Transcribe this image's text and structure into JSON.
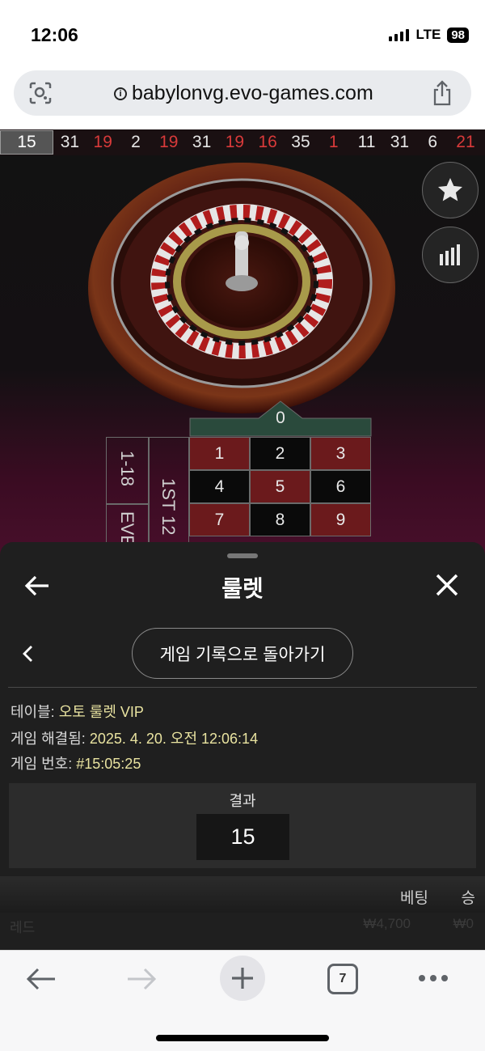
{
  "status": {
    "time": "12:06",
    "network": "LTE",
    "battery": "98"
  },
  "browser": {
    "url": "babylonvg.evo-games.com",
    "tab_count": "7"
  },
  "game": {
    "history": [
      {
        "n": "15",
        "c": "current"
      },
      {
        "n": "31",
        "c": "black"
      },
      {
        "n": "19",
        "c": "red"
      },
      {
        "n": "2",
        "c": "black"
      },
      {
        "n": "19",
        "c": "red"
      },
      {
        "n": "31",
        "c": "black"
      },
      {
        "n": "19",
        "c": "red"
      },
      {
        "n": "16",
        "c": "red"
      },
      {
        "n": "35",
        "c": "black"
      },
      {
        "n": "1",
        "c": "red"
      },
      {
        "n": "11",
        "c": "black"
      },
      {
        "n": "31",
        "c": "black"
      },
      {
        "n": "6",
        "c": "black"
      },
      {
        "n": "21",
        "c": "red"
      }
    ],
    "zero_label": "0",
    "cells": [
      {
        "n": "1",
        "c": "red"
      },
      {
        "n": "2",
        "c": "black"
      },
      {
        "n": "3",
        "c": "red"
      },
      {
        "n": "4",
        "c": "black"
      },
      {
        "n": "5",
        "c": "red"
      },
      {
        "n": "6",
        "c": "black"
      },
      {
        "n": "7",
        "c": "red"
      },
      {
        "n": "8",
        "c": "black"
      },
      {
        "n": "9",
        "c": "red"
      }
    ],
    "outside_low": "1-18",
    "outside_even": "EVEN",
    "dozen_first": "1ST 12"
  },
  "sheet": {
    "title": "룰렛",
    "history_button": "게임 기록으로 돌아가기",
    "table_label": "테이블: ",
    "table_value": "오토 룰렛 VIP",
    "resolved_label": "게임 해결됨: ",
    "resolved_value": "2025. 4. 20. 오전 12:06:14",
    "game_no_label": "게임 번호: ",
    "game_no_value": "#15:05:25",
    "result_title": "결과",
    "result_value": "15",
    "col_bet": "베팅",
    "col_win": "승",
    "faded_row_left": "레드",
    "faded_row_mid": "₩4,700",
    "faded_row_right": "₩0"
  },
  "colors": {
    "red": "#6b1a1c",
    "black": "#0a0a0a",
    "accent_text": "#e9e3a0"
  }
}
